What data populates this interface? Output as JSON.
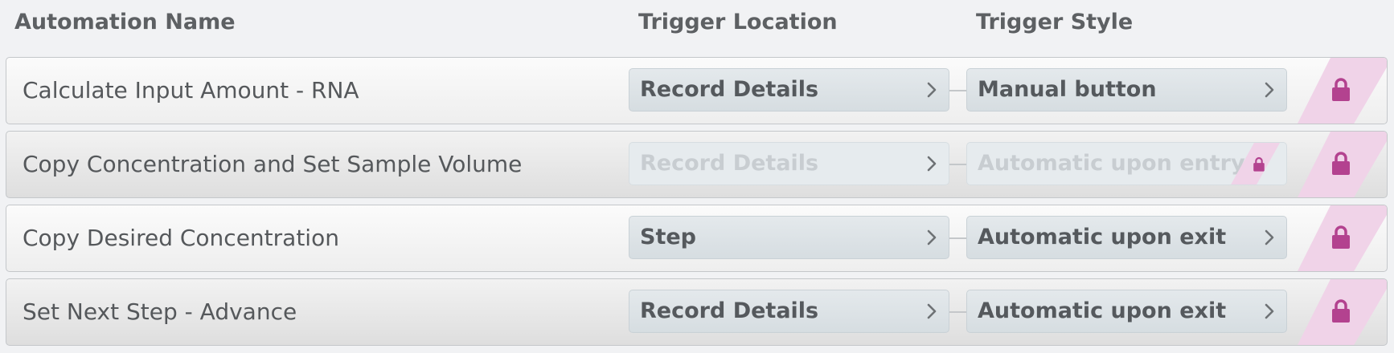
{
  "columns": {
    "name": "Automation Name",
    "location": "Trigger Location",
    "style": "Trigger Style"
  },
  "rows": [
    {
      "name": "Calculate Input Amount - RNA",
      "location": "Record Details",
      "style": "Manual button",
      "style_locked": false,
      "disabled": false
    },
    {
      "name": "Copy Concentration and Set Sample Volume",
      "location": "Record Details",
      "style": "Automatic upon entry",
      "style_locked": true,
      "disabled": true
    },
    {
      "name": "Copy Desired Concentration",
      "location": "Step",
      "style": "Automatic upon exit",
      "style_locked": false,
      "disabled": false
    },
    {
      "name": "Set Next Step - Advance",
      "location": "Record Details",
      "style": "Automatic upon exit",
      "style_locked": false,
      "disabled": false
    }
  ],
  "icons": {
    "row_lock": "lock-icon",
    "arrow": "chevron-right-icon"
  },
  "colors": {
    "lock": "#b3428f",
    "lock_stripe": "#f0d3e8",
    "pill_bg": "#dae1e5",
    "text": "#55585b"
  }
}
